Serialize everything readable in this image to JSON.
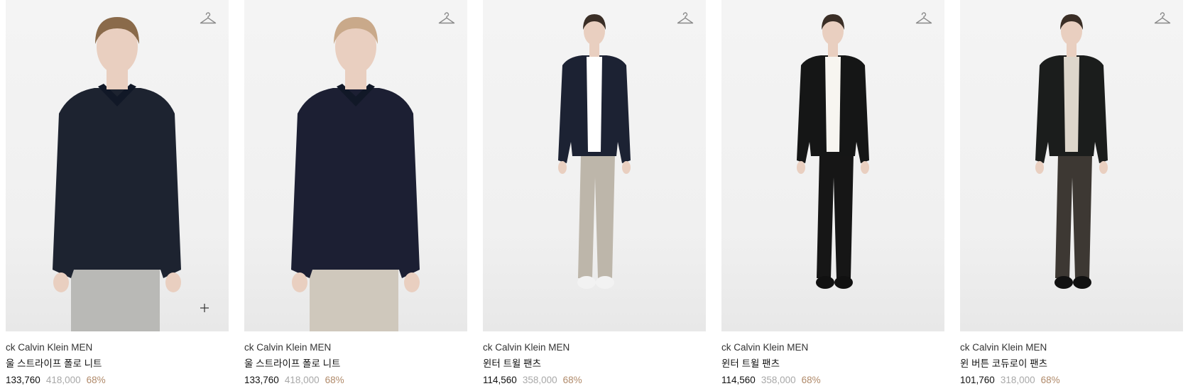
{
  "products": [
    {
      "brand": "ck Calvin Klein MEN",
      "name": "울 스트라이프 폴로 니트",
      "price": "133,760",
      "original_price": "418,000",
      "discount": "68%",
      "outfit": {
        "hair": "#8a6a4a",
        "top": "#1d2330",
        "bottom": "#b9b9b6",
        "inner": "",
        "shoes": "",
        "shot": "half"
      }
    },
    {
      "brand": "ck Calvin Klein MEN",
      "name": "울 스트라이프 폴로 니트",
      "price": "133,760",
      "original_price": "418,000",
      "discount": "68%",
      "outfit": {
        "hair": "#c9a98a",
        "top": "#1c1f33",
        "bottom": "#cfc8bc",
        "inner": "",
        "shoes": "",
        "shot": "half"
      }
    },
    {
      "brand": "ck Calvin Klein MEN",
      "name": "윈터 트윌 팬츠",
      "price": "114,560",
      "original_price": "358,000",
      "discount": "68%",
      "outfit": {
        "hair": "#3a2e26",
        "top": "#1c2233",
        "bottom": "#bdb6aa",
        "inner": "#ffffff",
        "shoes": "#f2f2f2",
        "shot": "full"
      }
    },
    {
      "brand": "ck Calvin Klein MEN",
      "name": "윈터 트윌 팬츠",
      "price": "114,560",
      "original_price": "358,000",
      "discount": "68%",
      "outfit": {
        "hair": "#3a2e26",
        "top": "#151616",
        "bottom": "#161616",
        "inner": "#f7f5f0",
        "shoes": "#111111",
        "shot": "full"
      }
    },
    {
      "brand": "ck Calvin Klein MEN",
      "name": "윈 버튼 코듀로이 팬츠",
      "price": "101,760",
      "original_price": "318,000",
      "discount": "68%",
      "outfit": {
        "hair": "#3a2e26",
        "top": "#1b1d1c",
        "bottom": "#3d3833",
        "inner": "#ddd6cb",
        "shoes": "#111111",
        "shot": "full"
      }
    }
  ],
  "icons": {
    "wishlist": "hanger-icon",
    "quick_add": "plus-icon"
  },
  "colors": {
    "discount": "#b08a6a",
    "original_price": "#a8a8a8"
  }
}
